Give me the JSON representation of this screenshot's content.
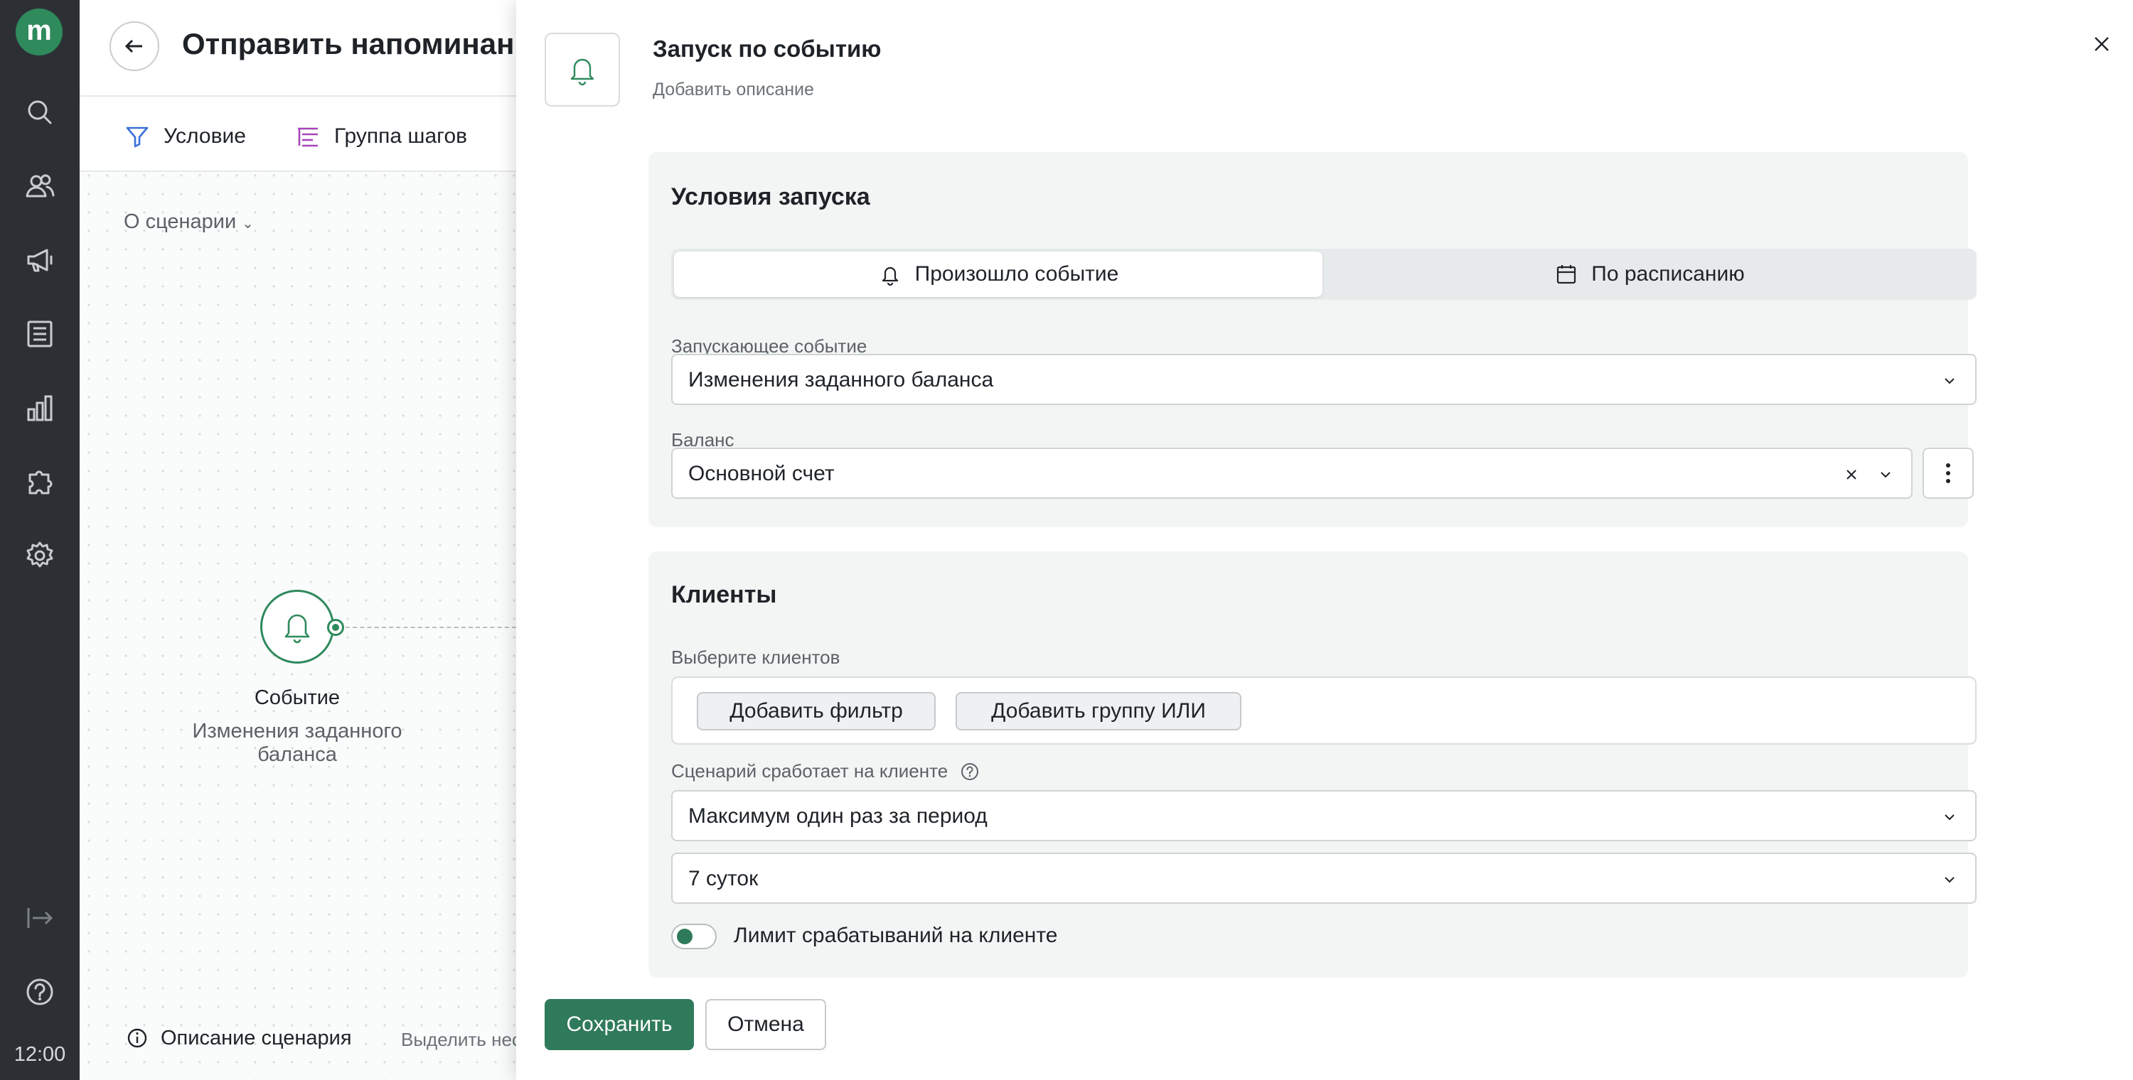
{
  "sidebar": {
    "logo_letter": "m",
    "nav_icons": [
      "search-icon",
      "users-icon",
      "megaphone-icon",
      "list-icon",
      "chart-icon",
      "puzzle-icon",
      "gear-icon"
    ],
    "bottom_icons": [
      "collapse-arrow-icon",
      "help-icon"
    ],
    "clock": "12:00"
  },
  "background_page": {
    "title": "Отправить напоминание",
    "toolbar": {
      "condition_label": "Условие",
      "step_group_label": "Группа шагов"
    },
    "about_label": "О сценарии",
    "node": {
      "title": "Событие",
      "subtitle": "Изменения заданного баланса"
    },
    "footer": {
      "description_label": "Описание сценария",
      "hint": "Выделить нес"
    }
  },
  "panel": {
    "title": "Запуск по событию",
    "description_placeholder": "Добавить описание",
    "launch_conditions": {
      "heading": "Условия запуска",
      "tabs": [
        {
          "label": "Произошло событие",
          "active": true
        },
        {
          "label": "По расписанию",
          "active": false
        }
      ],
      "trigger_event": {
        "label": "Запускающее событие",
        "value": "Изменения заданного баланса"
      },
      "balance": {
        "label": "Баланс",
        "value": "Основной счет"
      }
    },
    "clients": {
      "heading": "Клиенты",
      "select_label": "Выберите клиентов",
      "add_filter_label": "Добавить фильтр",
      "add_or_group_label": "Добавить группу ИЛИ",
      "trigger_on_client_label": "Сценарий сработает на клиенте",
      "frequency_value": "Максимум один раз за период",
      "period_value": "7 суток",
      "limit_toggle_label": "Лимит срабатываний на клиенте",
      "limit_toggle_on": false
    },
    "actions": {
      "save_label": "Сохранить",
      "cancel_label": "Отмена"
    }
  },
  "colors": {
    "brand_green": "#2f8a5c",
    "save_button": "#2f7a5a",
    "sidebar_bg": "#2c3035",
    "card_bg": "#f3f5f5"
  }
}
